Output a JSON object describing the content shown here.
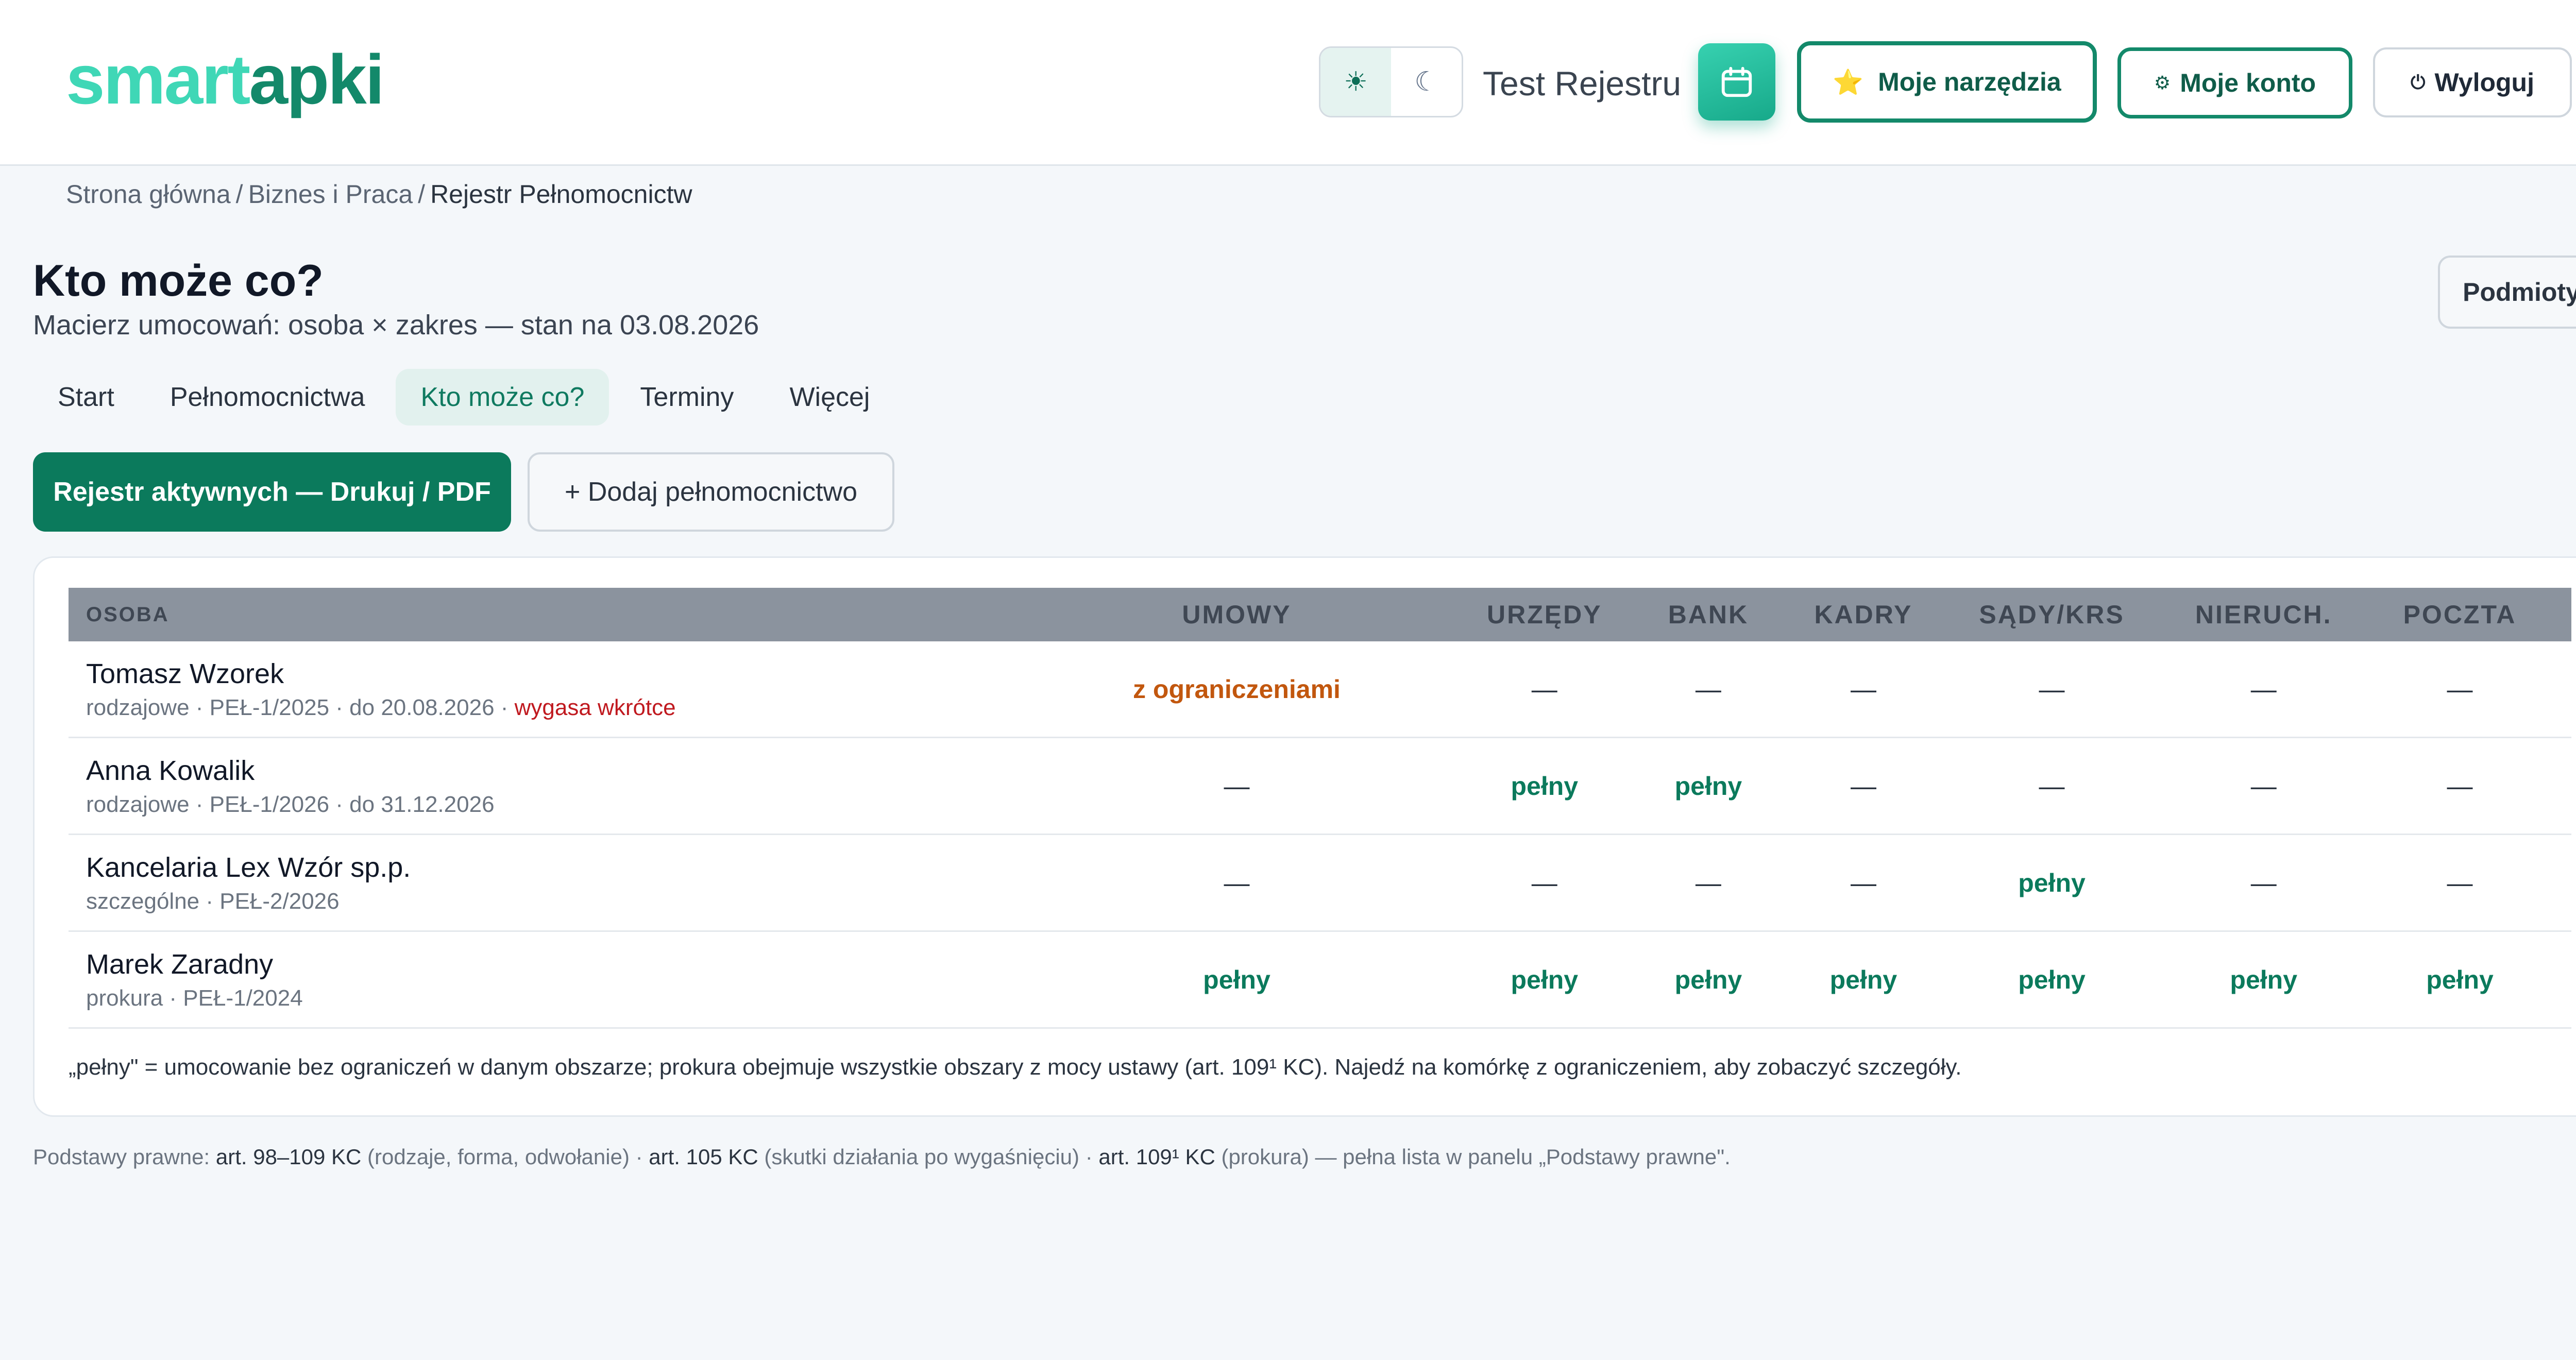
{
  "header": {
    "logo_part1": "smart",
    "logo_part2": "apki",
    "theme_light_icon": "☀",
    "theme_dark_icon": "☾",
    "user_name": "Test Rejestru",
    "calendar_icon": "calendar-icon",
    "tools_icon": "⭐",
    "tools_label": "Moje narzędzia",
    "account_icon": "⚙",
    "account_label": "Moje konto",
    "logout_icon": "⏻",
    "logout_label": "Wyloguj"
  },
  "breadcrumb": {
    "items": [
      "Strona główna",
      "Biznes i Praca",
      "Rejestr Pełnomocnictw"
    ],
    "separator": "/"
  },
  "page": {
    "title": "Kto może co?",
    "subtitle": "Macierz umocowań: osoba × zakres — stan na 03.08.2026",
    "podmioty_label": "Podmioty"
  },
  "tabs": [
    {
      "label": "Start",
      "active": false
    },
    {
      "label": "Pełnomocnictwa",
      "active": false
    },
    {
      "label": "Kto może co?",
      "active": true
    },
    {
      "label": "Terminy",
      "active": false
    },
    {
      "label": "Więcej",
      "active": false
    }
  ],
  "actions": {
    "print_label": "Rejestr aktywnych — Drukuj / PDF",
    "add_label": "+ Dodaj pełnomocnictwo"
  },
  "table": {
    "columns": [
      "OSOBA",
      "UMOWY",
      "URZĘDY",
      "BANK",
      "KADRY",
      "SĄDY/KRS",
      "NIERUCH.",
      "POCZTA"
    ],
    "rows": [
      {
        "name": "Tomasz Wzorek",
        "meta": "rodzajowe · PEŁ-1/2025 · do 20.08.2026 · ",
        "warning": "wygasa wkrótce",
        "cells": [
          "z ograniczeniami",
          "—",
          "—",
          "—",
          "—",
          "—",
          "—"
        ]
      },
      {
        "name": "Anna Kowalik",
        "meta": "rodzajowe · PEŁ-1/2026 · do 31.12.2026",
        "warning": "",
        "cells": [
          "—",
          "pełny",
          "pełny",
          "—",
          "—",
          "—",
          "—"
        ]
      },
      {
        "name": "Kancelaria Lex Wzór sp.p.",
        "meta": "szczególne · PEŁ-2/2026",
        "warning": "",
        "cells": [
          "—",
          "—",
          "—",
          "—",
          "pełny",
          "—",
          "—"
        ]
      },
      {
        "name": "Marek Zaradny",
        "meta": "prokura · PEŁ-1/2024",
        "warning": "",
        "cells": [
          "pełny",
          "pełny",
          "pełny",
          "pełny",
          "pełny",
          "pełny",
          "pełny"
        ]
      }
    ],
    "note": "„pełny\" = umocowanie bez ograniczeń w danym obszarze; prokura obejmuje wszystkie obszary z mocy ustawy (art. 109¹ KC). Najedź na komórkę z ograniczeniem, aby zobaczyć szczegóły."
  },
  "footer": {
    "prefix": "Podstawy prawne: ",
    "a1": "art. 98–109 KC",
    "d1": " (rodzaje, forma, odwołanie) · ",
    "a2": "art. 105 KC",
    "d2": " (skutki działania po wygaśnięciu) · ",
    "a3": "art. 109¹ KC",
    "d3": " (prokura) — pełna lista w panelu „Podstawy prawne\"."
  },
  "colors": {
    "brand_light": "#3fd7b6",
    "brand_dark": "#13896a",
    "primary_button": "#0b7a5c",
    "full_value": "#0b7a5c",
    "limited_value": "#c2570e",
    "warning": "#c0191f"
  }
}
